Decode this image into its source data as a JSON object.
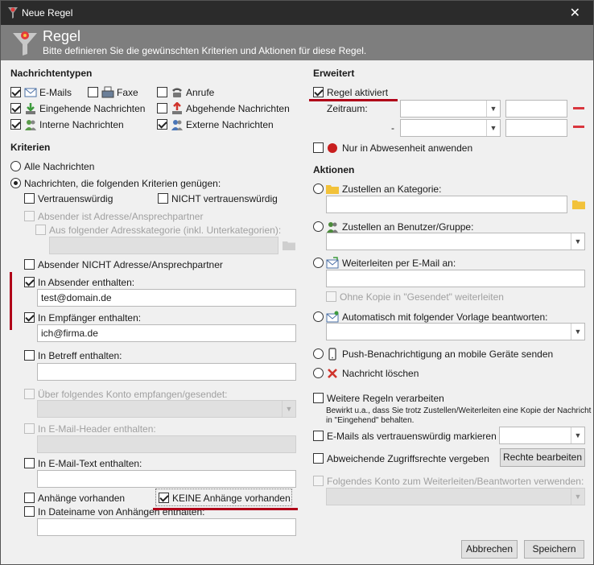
{
  "window": {
    "title": "Neue Regel",
    "close_symbol": "✕"
  },
  "header": {
    "title": "Regel",
    "subtitle": "Bitte definieren Sie die gewünschten Kriterien und Aktionen für diese Regel."
  },
  "nachrichtentypen": {
    "heading": "Nachrichtentypen",
    "emails": "E-Mails",
    "faxe": "Faxe",
    "anrufe": "Anrufe",
    "eingehend": "Eingehende Nachrichten",
    "abgehend": "Abgehende Nachrichten",
    "intern": "Interne Nachrichten",
    "extern": "Externe Nachrichten"
  },
  "kriterien": {
    "heading": "Kriterien",
    "alle": "Alle Nachrichten",
    "folgende": "Nachrichten, die folgenden Kriterien genügen:",
    "vertrauenswuerdig": "Vertrauenswürdig",
    "nicht_vertrauenswuerdig": "NICHT vertrauenswürdig",
    "absender_ist_adresse": "Absender ist Adresse/Ansprechpartner",
    "aus_kategorie": "Aus folgender Adresskategorie (inkl. Unterkategorien):",
    "absender_nicht_adresse": "Absender NICHT Adresse/Ansprechpartner",
    "in_absender": "In Absender enthalten:",
    "in_absender_value": "test@domain.de",
    "in_empfaenger": "In Empfänger enthalten:",
    "in_empfaenger_value": "ich@firma.de",
    "in_betreff": "In Betreff enthalten:",
    "in_betreff_value": "",
    "ueber_konto": "Über folgendes Konto empfangen/gesendet:",
    "in_header": "In E-Mail-Header enthalten:",
    "in_text": "In E-Mail-Text enthalten:",
    "in_text_value": "",
    "anhaenge": "Anhänge vorhanden",
    "keine_anhaenge": "KEINE Anhänge vorhanden",
    "dateiname": "In Dateiname von Anhängen enthalten:",
    "dateiname_value": ""
  },
  "erweitert": {
    "heading": "Erweitert",
    "regel_aktiviert": "Regel aktiviert",
    "zeitraum": "Zeitraum:",
    "dash": "-",
    "abwesenheit": "Nur in Abwesenheit anwenden"
  },
  "aktionen": {
    "heading": "Aktionen",
    "kategorie": "Zustellen an Kategorie:",
    "benutzer": "Zustellen an Benutzer/Gruppe:",
    "weiterleiten": "Weiterleiten per E-Mail an:",
    "ohne_kopie": "Ohne Kopie in \"Gesendet\" weiterleiten",
    "vorlage": "Automatisch mit folgender Vorlage beantworten:",
    "push": "Push-Benachrichtigung an mobile Geräte senden",
    "loeschen": "Nachricht löschen",
    "weitere_regeln": "Weitere Regeln verarbeiten",
    "weitere_regeln_note_1": "Bewirkt u.a., dass Sie trotz Zustellen/Weiterleiten eine Kopie der Nachricht",
    "weitere_regeln_note_2": "in \"Eingehend\" behalten.",
    "vertrauenswuerdig_markieren": "E-Mails als vertrauenswürdig markieren",
    "zugriffsrechte": "Abweichende Zugriffsrechte vergeben",
    "rechte_button": "Rechte bearbeiten",
    "konto_weiterleiten": "Folgendes Konto zum Weiterleiten/Beantworten verwenden:"
  },
  "footer": {
    "abbrechen": "Abbrechen",
    "speichern": "Speichern"
  },
  "colors": {
    "titlebar": "#2b2b2b",
    "header": "#7e7e7e",
    "annotation": "#b00018",
    "minus": "#d9363e"
  }
}
